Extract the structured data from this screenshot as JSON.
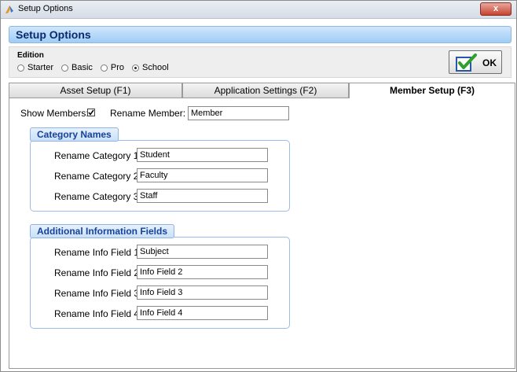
{
  "window": {
    "title": "Setup Options",
    "close_label": "x"
  },
  "header": {
    "title": "Setup Options"
  },
  "edition": {
    "label": "Edition",
    "options": [
      "Starter",
      "Basic",
      "Pro",
      "School"
    ],
    "selected": "School"
  },
  "ok_button": {
    "label": "OK"
  },
  "tabs": [
    {
      "label": "Asset Setup (F1)"
    },
    {
      "label": "Application Settings (F2)"
    },
    {
      "label": "Member Setup (F3)"
    }
  ],
  "member_setup": {
    "show_members_label": "Show Members:",
    "show_members_checked": true,
    "rename_member_label": "Rename Member:",
    "rename_member_value": "Member",
    "category_names": {
      "title": "Category Names",
      "fields": [
        {
          "label": "Rename Category 1:",
          "value": "Student"
        },
        {
          "label": "Rename Category 2:",
          "value": "Faculty"
        },
        {
          "label": "Rename Category 3:",
          "value": "Staff"
        }
      ]
    },
    "additional_info": {
      "title": "Additional Information Fields",
      "fields": [
        {
          "label": "Rename Info Field 1:",
          "value": "Subject"
        },
        {
          "label": "Rename Info Field 2:",
          "value": "Info Field 2"
        },
        {
          "label": "Rename Info Field 3:",
          "value": "Info Field 3"
        },
        {
          "label": "Rename Info Field 4:",
          "value": "Info Field 4"
        }
      ]
    }
  }
}
